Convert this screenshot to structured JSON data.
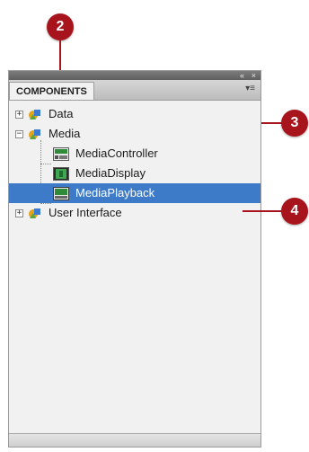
{
  "callouts": [
    "2",
    "3",
    "4"
  ],
  "panel": {
    "tab_label": "COMPONENTS",
    "topbar_buttons": [
      "«",
      "×"
    ],
    "menu_glyph": "▾≡"
  },
  "tree": {
    "items": [
      {
        "label": "Data",
        "toggle": "+",
        "icon": "folder-icon"
      },
      {
        "label": "Media",
        "toggle": "−",
        "icon": "folder-icon"
      },
      {
        "label": "MediaController",
        "icon": "media-controller-icon"
      },
      {
        "label": "MediaDisplay",
        "icon": "media-display-icon"
      },
      {
        "label": "MediaPlayback",
        "icon": "media-playback-icon",
        "selected": true
      },
      {
        "label": "User Interface",
        "toggle": "+",
        "icon": "folder-icon"
      }
    ]
  },
  "colors": {
    "callout": "#a8141c",
    "selection": "#3d7bc8",
    "panel_bg": "#f1f1f1"
  }
}
